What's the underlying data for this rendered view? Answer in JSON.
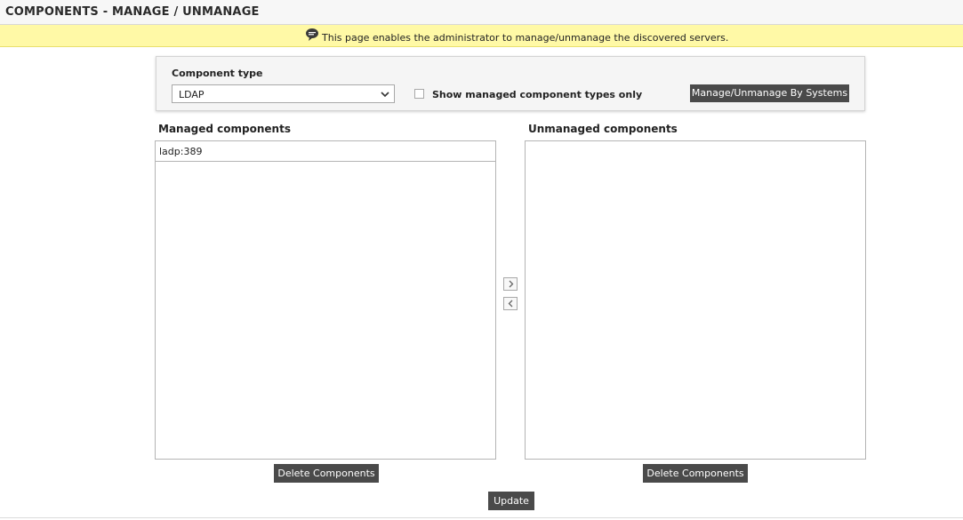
{
  "header": {
    "title": "COMPONENTS - MANAGE / UNMANAGE"
  },
  "banner": {
    "icon": "speech-bubble-icon",
    "text": "This page enables the administrator to manage/unmanage the discovered servers."
  },
  "filter": {
    "component_type_label": "Component type",
    "component_type_selected": "LDAP",
    "show_managed_label": "Show managed component types only",
    "show_managed_checked": false,
    "manage_by_systems_label": "Manage/Unmanage By Systems"
  },
  "managed": {
    "heading": "Managed components",
    "items": [
      "ladp:389"
    ],
    "delete_label": "Delete Components"
  },
  "unmanaged": {
    "heading": "Unmanaged components",
    "items": [],
    "delete_label": "Delete Components"
  },
  "actions": {
    "move_right_icon": "chevron-right-icon",
    "move_left_icon": "chevron-left-icon",
    "update_label": "Update"
  },
  "colors": {
    "banner_bg": "#fff9a6",
    "button_bg": "#4a4a4a",
    "header_bg": "#f7f7f7"
  }
}
